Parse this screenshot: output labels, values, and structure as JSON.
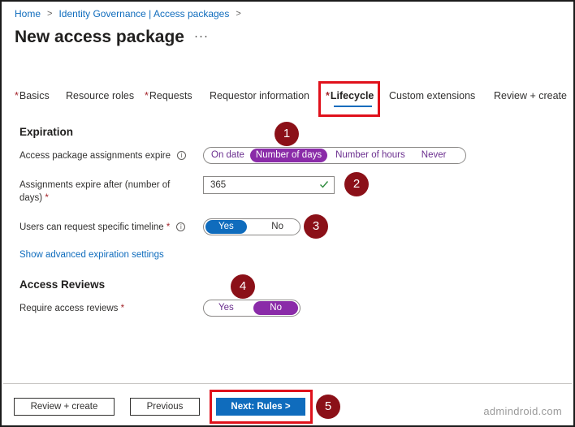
{
  "breadcrumb": {
    "home": "Home",
    "governance": "Identity Governance | Access packages",
    "separator": ">"
  },
  "page": {
    "title": "New access package",
    "more": "···"
  },
  "tabs": [
    {
      "label": "Basics",
      "required": "*",
      "active": false
    },
    {
      "label": "Resource roles",
      "required": "",
      "active": false
    },
    {
      "label": "Requests",
      "required": "*",
      "active": false
    },
    {
      "label": "Requestor information",
      "required": "",
      "active": false
    },
    {
      "label": "Lifecycle",
      "required": "*",
      "active": true
    },
    {
      "label": "Custom extensions",
      "required": "",
      "active": false
    },
    {
      "label": "Review + create",
      "required": "",
      "active": false
    }
  ],
  "expiration": {
    "heading": "Expiration",
    "expire_label": "Access package assignments expire",
    "expire_options": [
      "On date",
      "Number of days",
      "Number of hours",
      "Never"
    ],
    "expire_selected": "Number of days",
    "after_label": "Assignments expire after (number of days)",
    "after_required": "*",
    "after_value": "365",
    "timeline_label": "Users can request specific timeline",
    "timeline_required": "*",
    "timeline_options": [
      "Yes",
      "No"
    ],
    "timeline_selected": "Yes",
    "advanced_link": "Show advanced expiration settings"
  },
  "reviews": {
    "heading": "Access Reviews",
    "require_label": "Require access reviews",
    "require_required": "*",
    "require_options": [
      "Yes",
      "No"
    ],
    "require_selected": "No"
  },
  "badges": [
    "1",
    "2",
    "3",
    "4",
    "5"
  ],
  "footer": {
    "review_create": "Review + create",
    "previous": "Previous",
    "next": "Next: Rules >"
  },
  "watermark": "admindroid.com",
  "colors": {
    "accent_blue": "#0f6cbd",
    "selected_purple": "#8a2ba8",
    "badge_red": "#8b1018",
    "highlight_red": "#e0111b",
    "required_red": "#a4262c"
  }
}
